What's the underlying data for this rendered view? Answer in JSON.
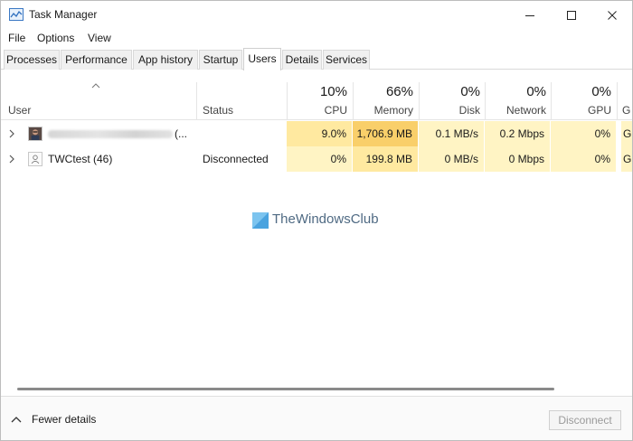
{
  "window": {
    "title": "Task Manager"
  },
  "menu": [
    "File",
    "Options",
    "View"
  ],
  "tabs": [
    "Processes",
    "Performance",
    "App history",
    "Startup",
    "Users",
    "Details",
    "Services"
  ],
  "active_tab": "Users",
  "columns": {
    "user": "User",
    "status": "Status",
    "cpu": {
      "label": "CPU",
      "pct": "10%"
    },
    "memory": {
      "label": "Memory",
      "pct": "66%"
    },
    "disk": {
      "label": "Disk",
      "pct": "0%"
    },
    "network": {
      "label": "Network",
      "pct": "0%"
    },
    "gpu": {
      "label": "GPU",
      "pct": "0%"
    },
    "gpu_engine_partial": "G"
  },
  "rows": [
    {
      "name_suffix": "(...",
      "status": "",
      "cpu": "9.0%",
      "memory": "1,706.9 MB",
      "disk": "0.1 MB/s",
      "network": "0.2 Mbps",
      "gpu": "0%",
      "gpu_engine": "GP"
    },
    {
      "name": "TWCtest (46)",
      "status": "Disconnected",
      "cpu": "0%",
      "memory": "199.8 MB",
      "disk": "0 MB/s",
      "network": "0 Mbps",
      "gpu": "0%",
      "gpu_engine": "GP"
    }
  ],
  "heat_colors": {
    "light": "#fff4c4",
    "medium": "#ffe9a0",
    "strong": "#f9cf6a"
  },
  "watermark": "TheWindowsClub",
  "footer": {
    "fewer_details": "Fewer details",
    "disconnect": "Disconnect"
  }
}
